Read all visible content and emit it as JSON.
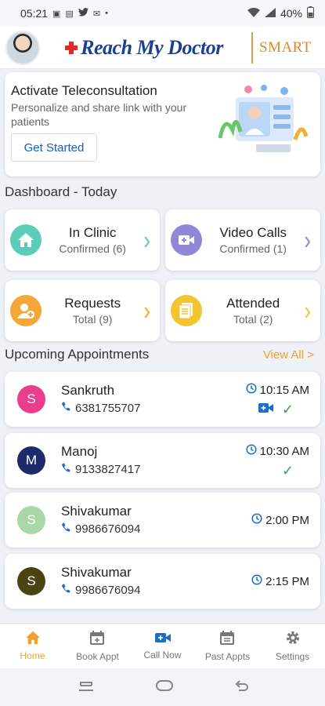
{
  "status_bar": {
    "time": "05:21",
    "battery": "40%"
  },
  "header": {
    "brand": "Reach My Doctor",
    "smart_label": "SMART"
  },
  "teleconsult": {
    "title": "Activate Teleconsultation",
    "subtitle": "Personalize and share link with your patients",
    "button_label": "Get Started"
  },
  "dashboard": {
    "title": "Dashboard - Today",
    "cards": [
      {
        "title": "In Clinic",
        "sub": "Confirmed (6)",
        "icon": "home-icon",
        "color": "#5ccdb8"
      },
      {
        "title": "Video Calls",
        "sub": "Confirmed (1)",
        "icon": "video-icon",
        "color": "#8f88d9"
      },
      {
        "title": "Requests",
        "sub": "Total (9)",
        "icon": "add-user-icon",
        "color": "#f3a73a"
      },
      {
        "title": "Attended",
        "sub": "Total (2)",
        "icon": "document-icon",
        "color": "#f4c430"
      }
    ]
  },
  "appointments": {
    "title": "Upcoming Appointments",
    "view_all": "View All >",
    "items": [
      {
        "initial": "S",
        "name": "Sankruth",
        "phone": "6381755707",
        "time": "10:15 AM",
        "avatar_color": "#e83e8c",
        "video": true,
        "confirmed": true
      },
      {
        "initial": "M",
        "name": "Manoj",
        "phone": "9133827417",
        "time": "10:30 AM",
        "avatar_color": "#1f2a6b",
        "video": false,
        "confirmed": true
      },
      {
        "initial": "S",
        "name": "Shivakumar",
        "phone": "9986676094",
        "time": "2:00 PM",
        "avatar_color": "#a8d8a8",
        "video": false,
        "confirmed": false
      },
      {
        "initial": "S",
        "name": "Shivakumar",
        "phone": "9986676094",
        "time": "2:15 PM",
        "avatar_color": "#4a4415",
        "video": false,
        "confirmed": false
      }
    ]
  },
  "bottom_nav": [
    {
      "label": "Home",
      "icon": "home-icon",
      "active": true
    },
    {
      "label": "Book Appt",
      "icon": "calendar-add-icon",
      "active": false
    },
    {
      "label": "Call Now",
      "icon": "video-icon",
      "active": false
    },
    {
      "label": "Past Appts",
      "icon": "calendar-history-icon",
      "active": false
    },
    {
      "label": "Settings",
      "icon": "gear-icon",
      "active": false
    }
  ],
  "colors": {
    "accent": "#f0a030",
    "brand": "#1d3f8f",
    "link": "#1a5fb4",
    "success": "#3aa84a"
  }
}
